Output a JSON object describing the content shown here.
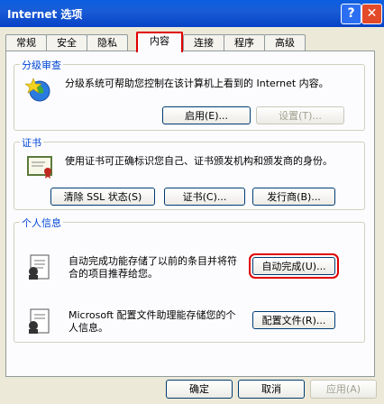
{
  "window": {
    "title": "Internet 选项",
    "help_glyph": "?",
    "close_glyph": "✕"
  },
  "tabs": [
    "常规",
    "安全",
    "隐私",
    "内容",
    "连接",
    "程序",
    "高级"
  ],
  "active_tab": "内容",
  "content_advisor": {
    "label": "分级审查",
    "description": "分级系统可帮助您控制在该计算机上看到的 Internet 内容。",
    "enable_button": "启用(E)...",
    "settings_button": "设置(T)..."
  },
  "certificates": {
    "label": "证书",
    "description": "使用证书可正确标识您自己、证书颁发机构和颁发商的身份。",
    "clear_ssl_button": "清除 SSL 状态(S)",
    "certificates_button": "证书(C)...",
    "publishers_button": "发行商(B)..."
  },
  "personal_info": {
    "label": "个人信息",
    "autocomplete_text": "自动完成功能存储了以前的条目并将符合的项目推荐给您。",
    "autocomplete_button": "自动完成(U)...",
    "profile_text": "Microsoft 配置文件助理能存储您的个人信息。",
    "profile_button": "配置文件(R)..."
  },
  "footer": {
    "ok": "确定",
    "cancel": "取消",
    "apply": "应用(A)"
  },
  "colors": {
    "titlebar": "#0a5fe0",
    "highlight": "#e00000",
    "group_label": "#0046d5",
    "face": "#ece9d8"
  }
}
